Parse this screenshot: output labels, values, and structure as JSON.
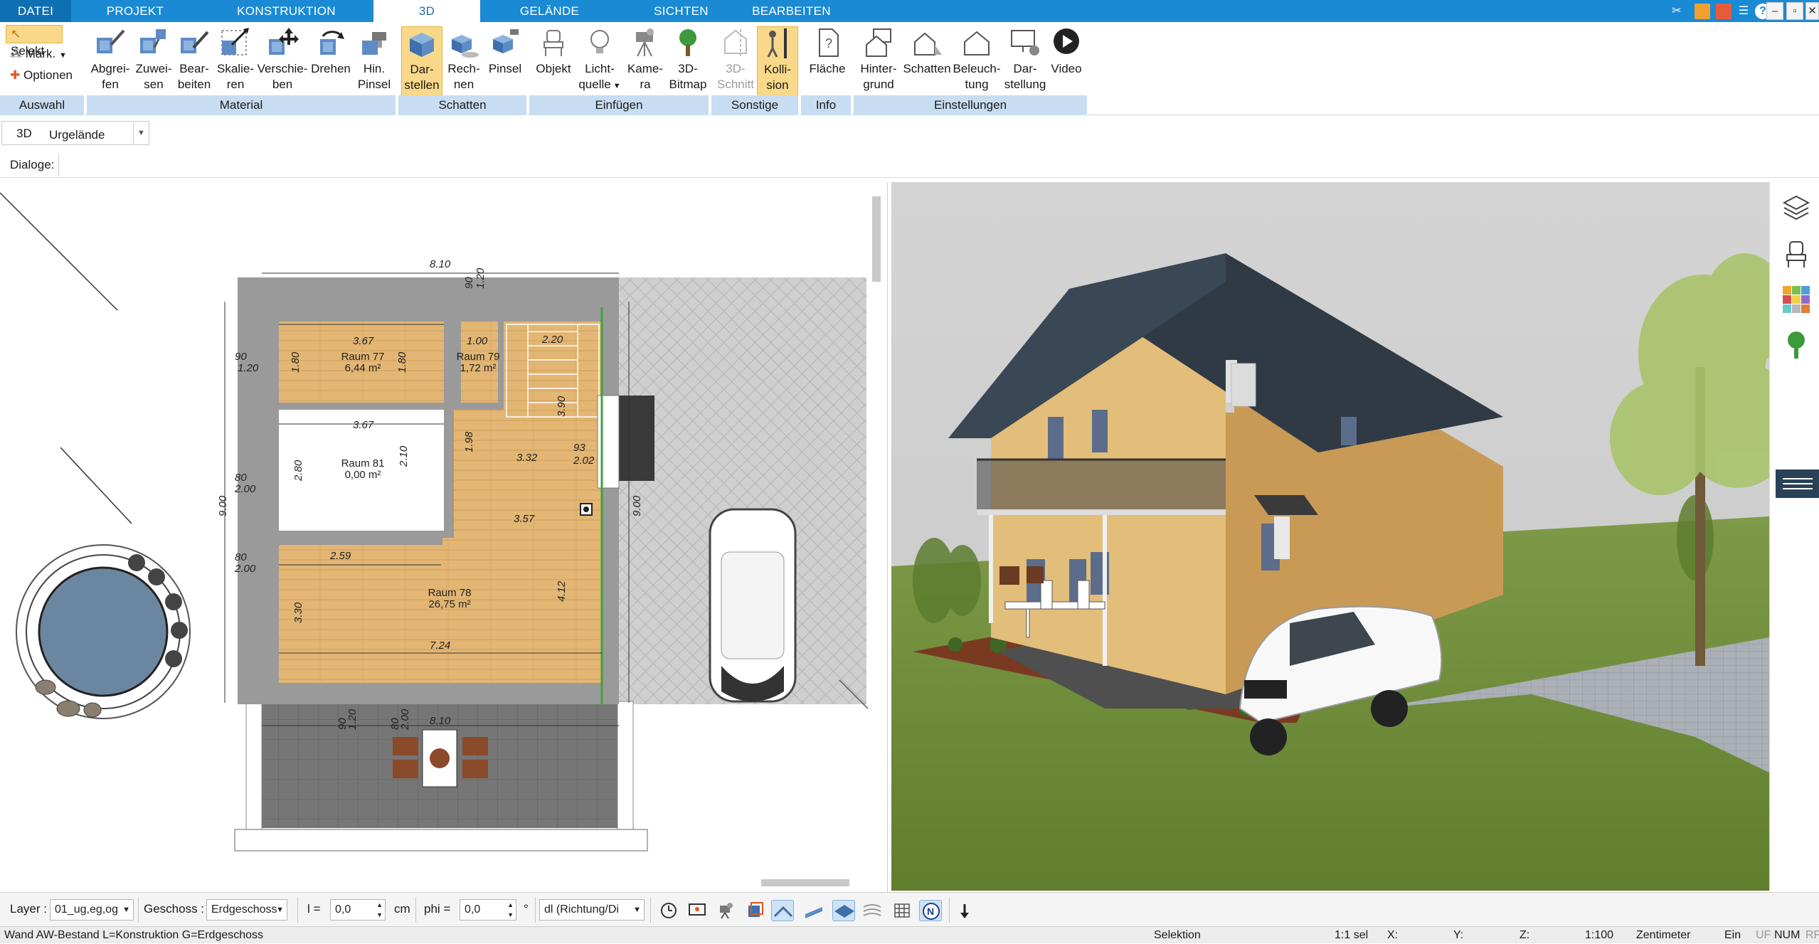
{
  "tabs": [
    {
      "label": "DATEI"
    },
    {
      "label": "PROJEKT"
    },
    {
      "label": "KONSTRUKTION"
    },
    {
      "label": "3D"
    },
    {
      "label": "GELÄNDE"
    },
    {
      "label": "SICHTEN"
    },
    {
      "label": "BEARBEITEN"
    }
  ],
  "active_tab": "3D",
  "auswahl": {
    "selekt": "Selekt",
    "mark": "Mark.",
    "optionen": "Optionen",
    "group": "Auswahl"
  },
  "material": {
    "group": "Material",
    "buttons": [
      {
        "l1": "Abgrei-",
        "l2": "fen",
        "icon": "eyedropper-icon"
      },
      {
        "l1": "Zuwei-",
        "l2": "sen",
        "icon": "assign-icon"
      },
      {
        "l1": "Bear-",
        "l2": "beiten",
        "icon": "edit-material-icon"
      },
      {
        "l1": "Skalie-",
        "l2": "ren",
        "icon": "scale-icon"
      },
      {
        "l1": "Verschie-",
        "l2": "ben",
        "icon": "move-icon"
      },
      {
        "l1": "Drehen",
        "l2": "",
        "icon": "rotate-icon"
      },
      {
        "l1": "Hin.",
        "l2": "Pinsel",
        "icon": "brush-icon"
      }
    ]
  },
  "schatten": {
    "group": "Schatten",
    "buttons": [
      {
        "l1": "Dar-",
        "l2": "stellen",
        "icon": "shadow-display-icon"
      },
      {
        "l1": "Rech-",
        "l2": "nen",
        "icon": "shadow-calc-icon"
      },
      {
        "l1": "Pinsel",
        "l2": "",
        "icon": "shadow-brush-icon"
      }
    ]
  },
  "einfuegen": {
    "group": "Einfügen",
    "buttons": [
      {
        "l1": "Objekt",
        "l2": "",
        "icon": "chair-icon"
      },
      {
        "l1": "Licht-",
        "l2": "quelle",
        "icon": "bulb-icon"
      },
      {
        "l1": "Kame-",
        "l2": "ra",
        "icon": "camera-icon"
      },
      {
        "l1": "3D-",
        "l2": "Bitmap",
        "icon": "tree-icon"
      }
    ]
  },
  "sonstige": {
    "group": "Sonstige",
    "buttons": [
      {
        "l1": "3D-",
        "l2": "Schnitt",
        "icon": "section-icon"
      },
      {
        "l1": "Kolli-",
        "l2": "sion",
        "icon": "collision-icon"
      }
    ]
  },
  "info": {
    "group": "Info",
    "buttons": [
      {
        "l1": "Fläche",
        "l2": "",
        "icon": "area-icon"
      }
    ]
  },
  "einstellungen": {
    "group": "Einstellungen",
    "buttons": [
      {
        "l1": "Hinter-",
        "l2": "grund",
        "icon": "background-icon"
      },
      {
        "l1": "Schatten",
        "l2": "",
        "icon": "house-shadow-icon"
      },
      {
        "l1": "Beleuch-",
        "l2": "tung",
        "icon": "lighting-icon"
      },
      {
        "l1": "Dar-",
        "l2": "stellung",
        "icon": "display-icon"
      },
      {
        "l1": "Video",
        "l2": "",
        "icon": "play-icon"
      }
    ]
  },
  "subbar": {
    "mode": "3D",
    "terrain": "Urgelände"
  },
  "dialogbar": {
    "label": "Dialoge:"
  },
  "plan": {
    "dims": {
      "top_width": "8.10",
      "bottom_width": "8.10",
      "left_height": "9.00",
      "right_height": "9.00",
      "r77_w": "3.67",
      "r77_h1": "1.80",
      "r77_h2": "1.80",
      "r79_w": "1.00",
      "stair_w": "2.20",
      "r81_w": "3.67",
      "r81_h": "2.80",
      "r81_h2": "2.10",
      "r78_top": "3.57",
      "r78_w1": "2.59",
      "r78_w2": "7.24",
      "r78_h": "3.30",
      "r78_h2": "4.12",
      "d_90a": "90",
      "d_120a": "1.20",
      "d_80a": "80",
      "d_200a": "2.00",
      "d_80b": "80",
      "d_200b": "2.00",
      "d_332": "3.32",
      "d_202": "2.02",
      "d_93": "93",
      "d_198": "1.98",
      "d_390": "3.90",
      "bot_90": "90",
      "bot_120": "1.20",
      "bot_80": "80",
      "bot_200": "2.00",
      "top_90": "90",
      "top_120": "1.20"
    },
    "rooms": [
      {
        "name": "Raum 77",
        "area": "6,44 m²"
      },
      {
        "name": "Raum 79",
        "area": "1,72 m²"
      },
      {
        "name": "Raum 81",
        "area": "0,00 m²"
      },
      {
        "name": "Raum 78",
        "area": "26,75 m²"
      }
    ]
  },
  "bottombar": {
    "layer_label": "Layer :",
    "layer_value": "01_ug,eg,og",
    "geschoss_label": "Geschoss :",
    "geschoss_value": "Erdgeschoss",
    "l_label": "l =",
    "l_value": "0,0",
    "l_unit": "cm",
    "phi_label": "phi =",
    "phi_value": "0,0",
    "phi_unit": "°",
    "dl_value": "dl (Richtung/Di"
  },
  "status": {
    "hint": "Wand AW-Bestand L=Konstruktion G=Erdgeschoss",
    "mode": "Selektion",
    "sel": "1:1 sel",
    "x": "X:",
    "y": "Y:",
    "z": "Z:",
    "scale": "1:100",
    "unit": "Zentimeter",
    "ein": "Ein",
    "uf": "UF",
    "num": "NUM",
    "rf": "RF"
  },
  "colors": {
    "ribbon_tab": "#1a8ad4",
    "group_label": "#c8ddf1",
    "highlight": "#f9d88a",
    "floor": "#e2b878",
    "paving": "#c9c9c9",
    "facade": "#d9ad6b",
    "roof": "#2f3a45",
    "grass": "#6f8e3a"
  }
}
